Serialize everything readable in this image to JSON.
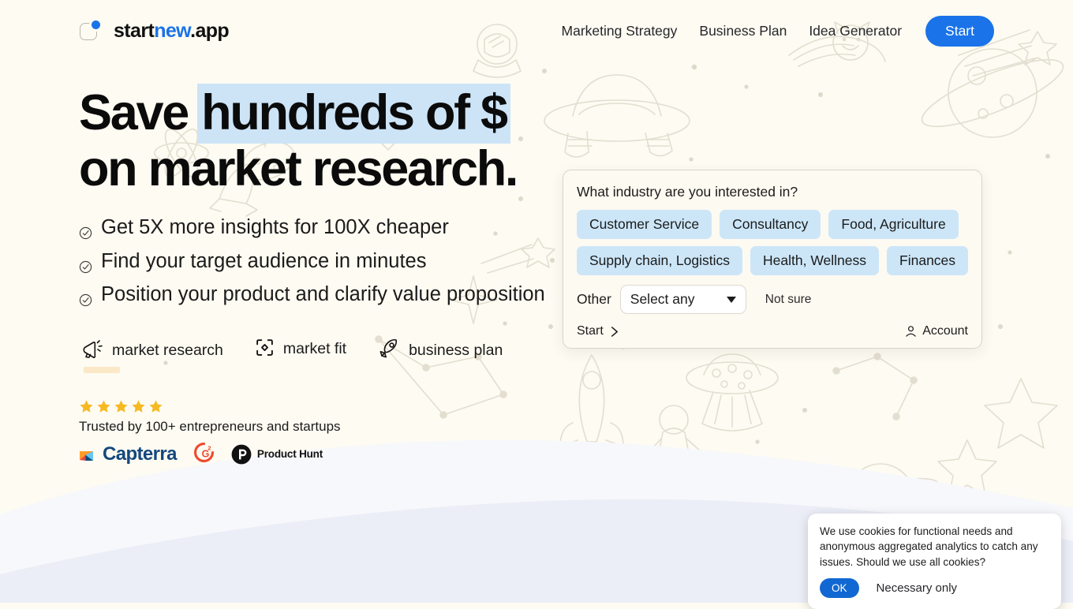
{
  "brand": {
    "mark_icon": "rounded-square-dot-logo-icon",
    "part1": "start",
    "part2": "new",
    "part3": ".app"
  },
  "nav": {
    "links": [
      {
        "label": "Marketing Strategy"
      },
      {
        "label": "Business Plan"
      },
      {
        "label": "Idea Generator"
      }
    ],
    "start_label": "Start"
  },
  "hero": {
    "headline_plain": "Save ",
    "headline_highlight": "hundreds of $",
    "headline_line2": "on market research.",
    "bullets": [
      {
        "text": "Get 5X more insights for 100X cheaper"
      },
      {
        "text": "Find your target audience in minutes"
      },
      {
        "text": "Position your product and clarify value proposition"
      }
    ],
    "feature_tabs": [
      {
        "label": "market research",
        "icon": "megaphone-icon",
        "active": true
      },
      {
        "label": "market fit",
        "icon": "focus-target-icon",
        "active": false
      },
      {
        "label": "business plan",
        "icon": "rocket-icon",
        "active": false
      }
    ],
    "rating_stars": 5,
    "trusted_text": "Trusted by 100+ entrepreneurs and startups",
    "logos": [
      {
        "name": "capterra-logo",
        "label": "Capterra"
      },
      {
        "name": "g2-logo",
        "label": "G2"
      },
      {
        "name": "product-hunt-logo",
        "label": "Product Hunt"
      }
    ]
  },
  "industry_card": {
    "question": "What industry are you interested in?",
    "chips_row1": [
      {
        "label": "Customer Service"
      },
      {
        "label": "Consultancy"
      },
      {
        "label": "Food, Agriculture"
      }
    ],
    "chips_row2": [
      {
        "label": "Supply chain, Logistics"
      },
      {
        "label": "Health, Wellness"
      },
      {
        "label": "Finances"
      }
    ],
    "other_label": "Other",
    "select_value": "Select any",
    "not_sure_label": "Not sure",
    "start_label": "Start",
    "account_label": "Account"
  },
  "cookie": {
    "message": "We use cookies for functional needs and anonymous aggregated analytics to catch any issues. Should we use all cookies?",
    "ok_label": "OK",
    "necessary_label": "Necessary only"
  },
  "colors": {
    "page_bg": "#fdfbf2",
    "accent_blue": "#1a73e8",
    "highlight_blue": "#cde4f7",
    "chip_blue": "#cce6f8",
    "star_yellow": "#f5b921",
    "underline_tan": "#fbe8c6",
    "wave_lavender": "#eceef7",
    "doodle_line": "#e3ded0"
  }
}
